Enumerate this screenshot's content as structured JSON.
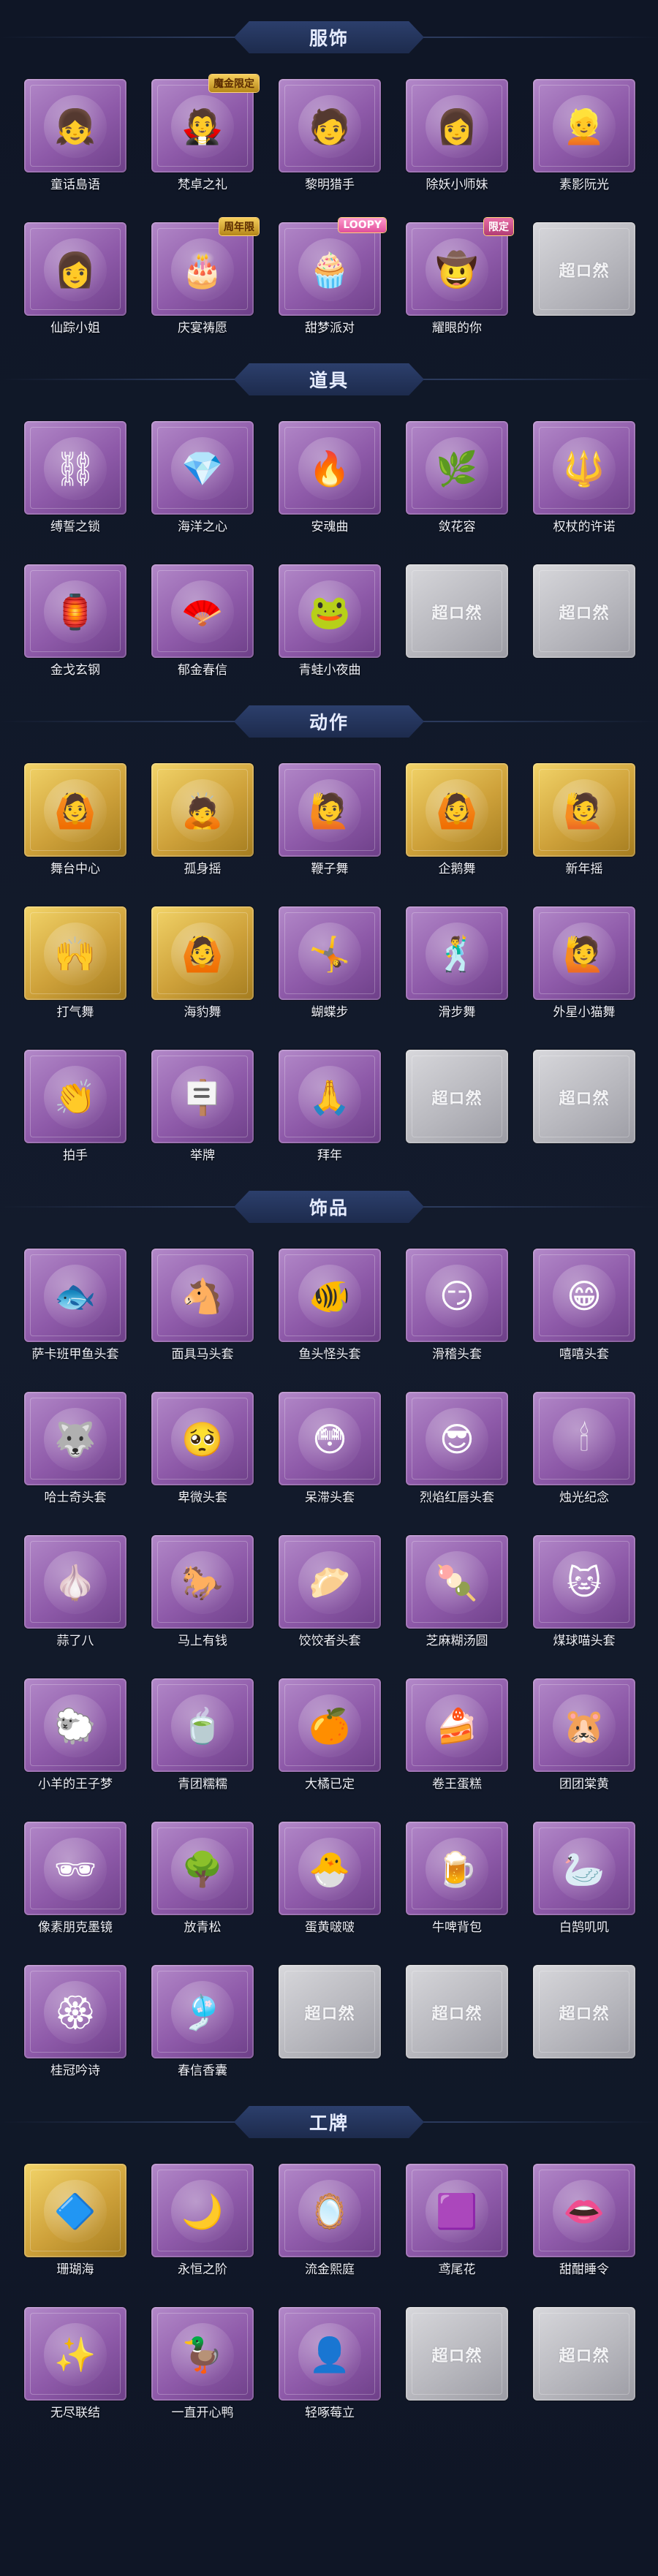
{
  "sections": [
    {
      "title": "服饰",
      "items": [
        {
          "label": "童话島语",
          "style": "purple",
          "icon": "👧",
          "icon_name": "costume-portrait-icon"
        },
        {
          "label": "梵卓之礼",
          "style": "purple",
          "icon": "🧛",
          "icon_name": "costume-portrait-icon",
          "badge": "魔金限定",
          "badge_style": "gold"
        },
        {
          "label": "黎明猎手",
          "style": "purple",
          "icon": "🧑",
          "icon_name": "costume-portrait-icon"
        },
        {
          "label": "除妖小师妹",
          "style": "purple",
          "icon": "👩",
          "icon_name": "costume-portrait-icon"
        },
        {
          "label": "素影阮光",
          "style": "purple",
          "icon": "👱",
          "icon_name": "costume-portrait-icon"
        },
        {
          "label": "仙踪小姐",
          "style": "purple",
          "icon": "👩",
          "icon_name": "costume-portrait-icon"
        },
        {
          "label": "庆宴祷愿",
          "style": "purple",
          "icon": "🎂",
          "icon_name": "costume-portrait-icon",
          "badge": "周年限",
          "badge_style": "gold"
        },
        {
          "label": "甜梦派对",
          "style": "purple",
          "icon": "🧁",
          "icon_name": "costume-portrait-icon",
          "badge": "LOOPY",
          "badge_style": "loopy"
        },
        {
          "label": "耀眼的你",
          "style": "purple",
          "icon": "🤠",
          "icon_name": "costume-portrait-icon",
          "badge": "限定",
          "badge_style": "pink"
        },
        {
          "label": "",
          "style": "gray",
          "icon": "超ロ然",
          "icon_name": "placeholder-logo-icon"
        }
      ]
    },
    {
      "title": "道具",
      "items": [
        {
          "label": "缚誓之锁",
          "style": "purple",
          "icon": "⛓",
          "icon_name": "chain-icon"
        },
        {
          "label": "海洋之心",
          "style": "purple",
          "icon": "💎",
          "icon_name": "necklace-icon"
        },
        {
          "label": "安魂曲",
          "style": "purple",
          "icon": "🔥",
          "icon_name": "flaming-blade-icon"
        },
        {
          "label": "敛花容",
          "style": "purple",
          "icon": "🌿",
          "icon_name": "floral-staff-icon"
        },
        {
          "label": "权杖的许诺",
          "style": "purple",
          "icon": "🔱",
          "icon_name": "scepter-icon"
        },
        {
          "label": "金戈玄钢",
          "style": "purple",
          "icon": "🏮",
          "icon_name": "lantern-icon"
        },
        {
          "label": "郁金春信",
          "style": "purple",
          "icon": "🪭",
          "icon_name": "fan-icon"
        },
        {
          "label": "青蛙小夜曲",
          "style": "purple",
          "icon": "🐸",
          "icon_name": "frog-icon"
        },
        {
          "label": "",
          "style": "gray",
          "icon": "超ロ然",
          "icon_name": "placeholder-logo-icon"
        },
        {
          "label": "",
          "style": "gray",
          "icon": "超ロ然",
          "icon_name": "placeholder-logo-icon"
        }
      ]
    },
    {
      "title": "动作",
      "items": [
        {
          "label": "舞台中心",
          "style": "gold",
          "icon": "🙆",
          "icon_name": "dance-pose-icon"
        },
        {
          "label": "孤身摇",
          "style": "gold",
          "icon": "🙇",
          "icon_name": "dance-pose-icon"
        },
        {
          "label": "鞭子舞",
          "style": "purple",
          "icon": "🙋",
          "icon_name": "dance-pose-icon"
        },
        {
          "label": "企鹅舞",
          "style": "gold",
          "icon": "🙆",
          "icon_name": "dance-pose-icon"
        },
        {
          "label": "新年摇",
          "style": "gold",
          "icon": "🙋",
          "icon_name": "dance-pose-icon"
        },
        {
          "label": "打气舞",
          "style": "gold",
          "icon": "🙌",
          "icon_name": "dance-pose-icon"
        },
        {
          "label": "海豹舞",
          "style": "gold",
          "icon": "🙆",
          "icon_name": "dance-pose-icon"
        },
        {
          "label": "蝴蝶步",
          "style": "purple",
          "icon": "🤸",
          "icon_name": "dance-pose-icon"
        },
        {
          "label": "滑步舞",
          "style": "purple",
          "icon": "🕺",
          "icon_name": "dance-pose-icon"
        },
        {
          "label": "外星小猫舞",
          "style": "purple",
          "icon": "🙋",
          "icon_name": "dance-pose-icon"
        },
        {
          "label": "拍手",
          "style": "purple",
          "icon": "👏",
          "icon_name": "clap-icon"
        },
        {
          "label": "举牌",
          "style": "purple",
          "icon": "🪧",
          "icon_name": "sign-icon"
        },
        {
          "label": "拜年",
          "style": "purple",
          "icon": "🙏",
          "icon_name": "greeting-icon"
        },
        {
          "label": "",
          "style": "gray",
          "icon": "超ロ然",
          "icon_name": "placeholder-logo-icon"
        },
        {
          "label": "",
          "style": "gray",
          "icon": "超ロ然",
          "icon_name": "placeholder-logo-icon"
        }
      ]
    },
    {
      "title": "饰品",
      "items": [
        {
          "label": "萨卡班甲鱼头套",
          "style": "purple",
          "icon": "🐟",
          "icon_name": "fish-head-icon"
        },
        {
          "label": "面具马头套",
          "style": "purple",
          "icon": "🐴",
          "icon_name": "horse-head-icon"
        },
        {
          "label": "鱼头怪头套",
          "style": "purple",
          "icon": "🐠",
          "icon_name": "fish-monster-icon"
        },
        {
          "label": "滑稽头套",
          "style": "purple",
          "icon": "😏",
          "icon_name": "smirk-face-icon"
        },
        {
          "label": "嘻嘻头套",
          "style": "purple",
          "icon": "😁",
          "icon_name": "grin-face-icon"
        },
        {
          "label": "哈士奇头套",
          "style": "purple",
          "icon": "🐺",
          "icon_name": "husky-head-icon"
        },
        {
          "label": "卑微头套",
          "style": "purple",
          "icon": "🥺",
          "icon_name": "humble-face-icon"
        },
        {
          "label": "呆滞头套",
          "style": "purple",
          "icon": "😳",
          "icon_name": "dazed-face-icon"
        },
        {
          "label": "烈焰红唇头套",
          "style": "purple",
          "icon": "😎",
          "icon_name": "sunglasses-head-icon"
        },
        {
          "label": "烛光纪念",
          "style": "purple",
          "icon": "🕯",
          "icon_name": "candle-icon"
        },
        {
          "label": "蒜了八",
          "style": "purple",
          "icon": "🧄",
          "icon_name": "garlic-icon"
        },
        {
          "label": "马上有钱",
          "style": "purple",
          "icon": "🐎",
          "icon_name": "horse-icon"
        },
        {
          "label": "饺饺者头套",
          "style": "purple",
          "icon": "🥟",
          "icon_name": "dumpling-icon"
        },
        {
          "label": "芝麻糊汤圆",
          "style": "purple",
          "icon": "🍡",
          "icon_name": "rice-ball-icon"
        },
        {
          "label": "煤球喵头套",
          "style": "purple",
          "icon": "🐱",
          "icon_name": "cat-head-icon"
        },
        {
          "label": "小羊的王子梦",
          "style": "purple",
          "icon": "🐑",
          "icon_name": "sheep-icon"
        },
        {
          "label": "青团糯糯",
          "style": "purple",
          "icon": "🍵",
          "icon_name": "green-ball-icon"
        },
        {
          "label": "大橘已定",
          "style": "purple",
          "icon": "🍊",
          "icon_name": "orange-icon"
        },
        {
          "label": "卷王蛋糕",
          "style": "purple",
          "icon": "🍰",
          "icon_name": "cake-roll-icon"
        },
        {
          "label": "团团棠黄",
          "style": "purple",
          "icon": "🐹",
          "icon_name": "hamster-icon"
        },
        {
          "label": "像素朋克墨镜",
          "style": "purple",
          "icon": "🕶",
          "icon_name": "pixel-sunglasses-icon"
        },
        {
          "label": "放青松",
          "style": "purple",
          "icon": "🌳",
          "icon_name": "pine-tree-icon"
        },
        {
          "label": "蛋黄啵啵",
          "style": "purple",
          "icon": "🐣",
          "icon_name": "egg-yolk-icon"
        },
        {
          "label": "牛啤背包",
          "style": "purple",
          "icon": "🍺",
          "icon_name": "beer-backpack-icon"
        },
        {
          "label": "白鹄叽叽",
          "style": "purple",
          "icon": "🦢",
          "icon_name": "swan-icon"
        },
        {
          "label": "桂冠吟诗",
          "style": "purple",
          "icon": "🏵",
          "icon_name": "laurel-ornament-icon"
        },
        {
          "label": "春信香囊",
          "style": "purple",
          "icon": "🎐",
          "icon_name": "sachet-icon"
        },
        {
          "label": "",
          "style": "gray",
          "icon": "超ロ然",
          "icon_name": "placeholder-logo-icon"
        },
        {
          "label": "",
          "style": "gray",
          "icon": "超ロ然",
          "icon_name": "placeholder-logo-icon"
        },
        {
          "label": "",
          "style": "gray",
          "icon": "超ロ然",
          "icon_name": "placeholder-logo-icon"
        }
      ]
    },
    {
      "title": "工牌",
      "items": [
        {
          "label": "珊瑚海",
          "style": "gold",
          "icon": "🔷",
          "icon_name": "crystal-badge-icon"
        },
        {
          "label": "永恒之阶",
          "style": "purple",
          "icon": "🌙",
          "icon_name": "moon-badge-icon"
        },
        {
          "label": "流金熙庭",
          "style": "purple",
          "icon": "🪞",
          "icon_name": "mirror-badge-icon"
        },
        {
          "label": "鸢尾花",
          "style": "purple",
          "icon": "🟪",
          "icon_name": "iris-badge-icon"
        },
        {
          "label": "甜酣睡令",
          "style": "purple",
          "icon": "👄",
          "icon_name": "mouth-badge-icon"
        },
        {
          "label": "无尽联结",
          "style": "purple",
          "icon": "✨",
          "icon_name": "infinite-badge-icon"
        },
        {
          "label": "一直开心鸭",
          "style": "purple",
          "icon": "🦆",
          "icon_name": "duck-badge-icon"
        },
        {
          "label": "轻啄莓立",
          "style": "purple",
          "icon": "👤",
          "icon_name": "silhouette-badge-icon"
        },
        {
          "label": "",
          "style": "gray",
          "icon": "超ロ然",
          "icon_name": "placeholder-logo-icon"
        },
        {
          "label": "",
          "style": "gray",
          "icon": "超ロ然",
          "icon_name": "placeholder-logo-icon"
        }
      ]
    }
  ]
}
